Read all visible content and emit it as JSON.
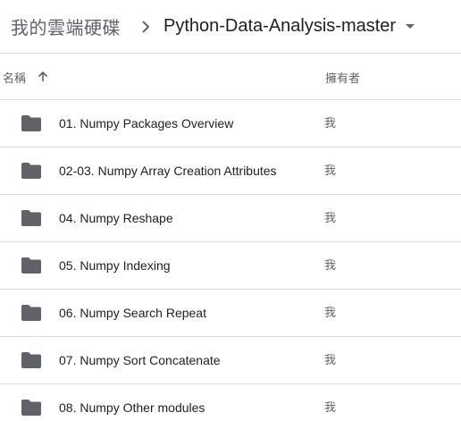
{
  "breadcrumb": {
    "root": "我的雲端硬碟",
    "current": "Python-Data-Analysis-master"
  },
  "columns": {
    "name": "名稱",
    "owner": "擁有者",
    "sort_direction": "ascending"
  },
  "icons": {
    "separator": "chevron-right-icon",
    "caret": "caret-down-icon",
    "sort": "arrow-up-icon",
    "folder": "folder-icon"
  },
  "colors": {
    "folder": "#5f6368",
    "divider": "#dadce0"
  },
  "files": [
    {
      "name": "01. Numpy Packages Overview",
      "owner": "我"
    },
    {
      "name": "02-03. Numpy Array Creation Attributes",
      "owner": "我"
    },
    {
      "name": "04. Numpy Reshape",
      "owner": "我"
    },
    {
      "name": "05. Numpy Indexing",
      "owner": "我"
    },
    {
      "name": "06. Numpy Search Repeat",
      "owner": "我"
    },
    {
      "name": "07. Numpy Sort Concatenate",
      "owner": "我"
    },
    {
      "name": "08. Numpy Other modules",
      "owner": "我"
    }
  ]
}
